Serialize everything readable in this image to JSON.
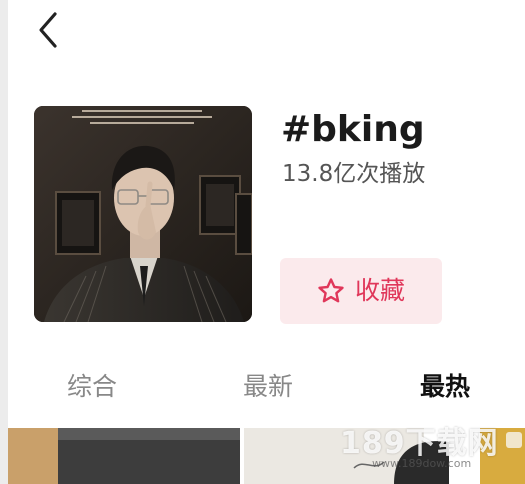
{
  "header": {
    "back_icon": "chevron-left-icon"
  },
  "topic": {
    "title": "#bking",
    "play_count": "13.8亿次播放"
  },
  "favorite_button": {
    "icon": "star-outline-icon",
    "label": "收藏",
    "color": "#e0375a"
  },
  "tabs": [
    {
      "label": "综合",
      "selected": false
    },
    {
      "label": "最新",
      "selected": false
    },
    {
      "label": "最热",
      "selected": true
    }
  ],
  "watermark": {
    "text": "189下载网",
    "sub": "www.189dow.com"
  }
}
